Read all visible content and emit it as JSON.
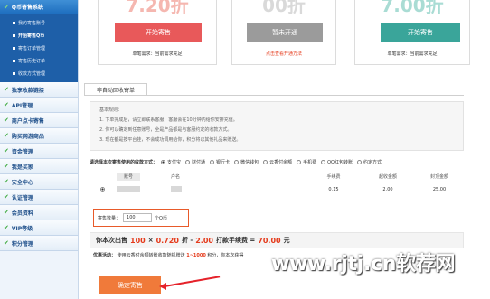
{
  "sidebar": {
    "section_title": "Q币寄售系统",
    "sub_items": [
      {
        "label": "我的寄售账号"
      },
      {
        "label": "开始寄售Q币"
      },
      {
        "label": "寄售订单管理"
      },
      {
        "label": "寄售历史订单"
      },
      {
        "label": "收款方式管理"
      }
    ],
    "categories": [
      {
        "label": "独享收款链接"
      },
      {
        "label": "API管理"
      },
      {
        "label": "商户点卡寄售"
      },
      {
        "label": "购买网游商品"
      },
      {
        "label": "资金管理"
      },
      {
        "label": "我是买家"
      },
      {
        "label": "安全中心"
      },
      {
        "label": "认证管理"
      },
      {
        "label": "会员资料"
      },
      {
        "label": "VIP等级"
      },
      {
        "label": "积分管理"
      }
    ]
  },
  "cards": [
    {
      "price": "7.20折",
      "button": "开始寄售",
      "note": "单笔需求：当前需求充足",
      "button_color": "#e8595a"
    },
    {
      "price": "00折",
      "button": "暂未开通",
      "note": "点击查看开通方法",
      "button_color": "#9b9b9b",
      "note_color": "#e53b1c"
    },
    {
      "price": "7.00折",
      "button": "开始寄售",
      "note": "单笔需求：当前需求充足",
      "button_color": "#3aa59a"
    }
  ],
  "main": {
    "tab_label": "非自动回收寄单",
    "info_lines": [
      "基本规则：",
      "1. 下单完成后，请立即联系客服，客服会在10分钟内给你安排充值。",
      "2. 你可以确定到任意账号，全是产品都是与客服约定的收款方式。",
      "3. 现在都是按平台挂，不会成功调用给你，积分将以其他礼品来赠送。"
    ],
    "pay_label": "请选择本次寄售使用的收款方式：",
    "pay_options": [
      "支付宝",
      "财付通",
      "银行卡",
      "微信钱包",
      "云香付余额",
      "手机费",
      "QQ红包转账",
      "约定方式"
    ],
    "table_headers": [
      "账号",
      "户名",
      "手续费",
      "起收金额",
      "封顶金额"
    ],
    "table_row": {
      "fee": "0.15",
      "min": "2.00",
      "max": "25.00"
    },
    "qty_label": "寄售数量：",
    "qty_value": "100",
    "qty_unit": "个Q币",
    "calc": {
      "prefix": "你本次出售",
      "amount": "100",
      "times": "×",
      "discount": "0.720",
      "zhe": "折 -",
      "fee": "2.00",
      "fee_label": "打款手续费 =",
      "total": "70.00",
      "unit": "元"
    },
    "promo_prefix": "优惠活动：",
    "promo_mid": "使用云香付余额转账收款随机赠送",
    "promo_range": "1~1000",
    "promo_suffix": "积分，你本次获得",
    "confirm_button": "确定寄售"
  },
  "watermark": "www.rjtj.cn软荐网",
  "colors": {
    "accent_blue": "#1f6fbf",
    "orange": "#f07a3a",
    "red": "#e53b1c"
  }
}
